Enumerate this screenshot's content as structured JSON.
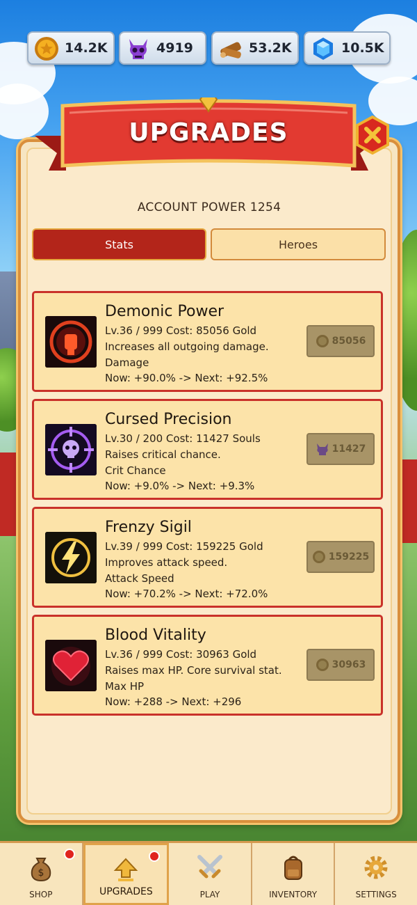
{
  "resources": [
    {
      "name": "gold-coin-icon",
      "value": "14.2K"
    },
    {
      "name": "demon-skull-icon",
      "value": "4919"
    },
    {
      "name": "wood-log-icon",
      "value": "53.2K"
    },
    {
      "name": "blue-gem-icon",
      "value": "10.5K"
    }
  ],
  "panel": {
    "title": "UPGRADES",
    "account_power": "ACCOUNT POWER 1254"
  },
  "tabs": [
    {
      "label": "Stats",
      "active": true
    },
    {
      "label": "Heroes",
      "active": false
    }
  ],
  "upgrades": [
    {
      "name": "Demonic Power",
      "level_cost": "Lv.36 / 999   Cost: 85056 Gold",
      "description": "Increases all outgoing damage.",
      "stat": "Damage",
      "progress": "Now: +90.0%  ->  Next: +92.5%",
      "button_value": "85056",
      "currency": "gold",
      "icon": "fist-icon"
    },
    {
      "name": "Cursed Precision",
      "level_cost": "Lv.30 / 200   Cost: 11427 Souls",
      "description": "Raises critical chance.",
      "stat": "Crit Chance",
      "progress": "Now: +9.0%  ->  Next: +9.3%",
      "button_value": "11427",
      "currency": "souls",
      "icon": "crosshair-skull-icon"
    },
    {
      "name": "Frenzy Sigil",
      "level_cost": "Lv.39 / 999   Cost: 159225 Gold",
      "description": "Improves attack speed.",
      "stat": "Attack Speed",
      "progress": "Now: +70.2%  ->  Next: +72.0%",
      "button_value": "159225",
      "currency": "gold",
      "icon": "lightning-icon"
    },
    {
      "name": "Blood Vitality",
      "level_cost": "Lv.36 / 999   Cost: 30963 Gold",
      "description": "Raises max HP. Core survival stat.",
      "stat": "Max HP",
      "progress": "Now: +288  ->  Next: +296",
      "button_value": "30963",
      "currency": "gold",
      "icon": "heart-icon"
    }
  ],
  "nav": [
    {
      "label": "SHOP",
      "icon": "money-bag-icon",
      "badge": true
    },
    {
      "label": "UPGRADES",
      "icon": "up-arrow-icon",
      "badge": true,
      "active": true
    },
    {
      "label": "PLAY",
      "icon": "crossed-swords-icon",
      "badge": false
    },
    {
      "label": "INVENTORY",
      "icon": "backpack-icon",
      "badge": false
    },
    {
      "label": "SETTINGS",
      "icon": "gear-icon",
      "badge": false
    }
  ],
  "colors": {
    "accent_red": "#b3251a",
    "panel_bg": "#fbeacb",
    "card_bg": "#fce3a9",
    "card_border": "#c9312a",
    "disabled_button": "#a89467"
  }
}
